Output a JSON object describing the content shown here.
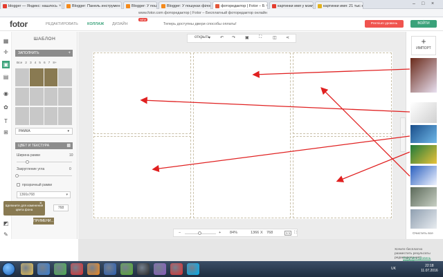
{
  "browser": {
    "tabs": [
      {
        "label": "blogger — Яндекс: нашлось",
        "color": "#e33c2e",
        "active": false
      },
      {
        "label": "Blogger: Панель инструмен",
        "color": "#f48a1c",
        "active": false
      },
      {
        "label": "Blogger: У пошуках філосо",
        "color": "#f48a1c",
        "active": false
      },
      {
        "label": "Blogger: У пошуках філосо",
        "color": "#f48a1c",
        "active": false
      },
      {
        "label": "фоторедактор | Fotor – Б",
        "color": "#e2563a",
        "active": true
      },
      {
        "label": "картинки имя у мэму м",
        "color": "#e33c2e",
        "active": false
      },
      {
        "label": "картинки имя: 21 тыс кар",
        "color": "#e3b21c",
        "active": false
      }
    ],
    "close_glyph": "×",
    "window_controls": [
      "–",
      "□",
      "×"
    ],
    "address": "www.fotor.com  фоторедактор | Fotor – Бесплатный фоторедактор онлайн"
  },
  "app": {
    "logo": "fotor",
    "nav": [
      {
        "label": "РЕДАКТИРОВАТЬ",
        "active": false
      },
      {
        "label": "КОЛЛАЖ",
        "active": true
      },
      {
        "label": "ДИЗАЙН",
        "active": false
      }
    ],
    "new_badge": "NEW",
    "notice": "Теперь доступны двери способы оплаты!",
    "premium_button": "Premium уровень",
    "login_button": "ВОЙТИ"
  },
  "left_panel": {
    "title": "ШАБЛОН",
    "fill_label": "ЗАПОЛНИТЬ",
    "fill_plus": "+",
    "numbers": [
      "Все",
      "2",
      "3",
      "4",
      "5",
      "6",
      "7",
      "8+"
    ],
    "frame_dropdown": "РАМКА",
    "frame_dropdown_arrow": "▾",
    "color_texture_label": "ЦВЕТ И ТЕКСТУРА",
    "border_width_label": "Ширина рамки",
    "border_width_value": "10",
    "corner_radius_label": "Закругление угла",
    "corner_radius_value": "0",
    "transparent_label": "прозрачный рамки",
    "resolution_select": "1366x768",
    "resolution_arrow": "▾",
    "height_value": "768",
    "apply_button": "ПРИМЕНИ...",
    "tip_text": "Щелкните для изменения цвета фона",
    "tip_close": "×"
  },
  "toolbar": {
    "open_label": "открыть",
    "open_arrow": "▾",
    "undo": "↶",
    "redo": "↷",
    "save": "▣",
    "fit": "⛶",
    "compare": "◫",
    "share": "⋖"
  },
  "zoom": {
    "minus": "−",
    "plus": "+",
    "percent": "84%",
    "width": "1366",
    "x": "X",
    "height": "768",
    "fit_icon": "1:1",
    "full_icon": "⛶"
  },
  "right_panel": {
    "import_plus": "+",
    "import_label": "ИМПОРТ",
    "collapse_arrow": "›",
    "clear_all": "Очистить все",
    "thumbs": [
      {
        "c1": "#6a2a1a",
        "c2": "#e8e0f0"
      },
      {
        "c1": "#ffffff",
        "c2": "#d0d0d0"
      },
      {
        "c1": "#1a4d8a",
        "c2": "#6fb8e8"
      },
      {
        "c1": "#1f7a3a",
        "c2": "#e8c23a"
      },
      {
        "c1": "#2a5fbf",
        "c2": "#f0f4ff"
      },
      {
        "c1": "#5c6a5a",
        "c2": "#c8d0c4"
      },
      {
        "c1": "#8f9fb0",
        "c2": "#e8ecf0"
      }
    ]
  },
  "promo": {
    "text": "Хочите бесплатно разместить результаты редактирования?",
    "link": "Получить уровень сейчас!"
  },
  "taskbar": {
    "lang": "UK",
    "time": "22:18",
    "date": "11.07.2016",
    "apps": [
      {
        "name": "explorer",
        "color": "#e8c050"
      },
      {
        "name": "media-player",
        "color": "#3a7fd0"
      },
      {
        "name": "chrome",
        "color": "#4caf50"
      },
      {
        "name": "opera",
        "color": "#e03030"
      },
      {
        "name": "firefox",
        "color": "#f08a20"
      },
      {
        "name": "word",
        "color": "#2b5fb3"
      },
      {
        "name": "utorrent",
        "color": "#58b030"
      },
      {
        "name": "app-8",
        "color": "#2a2a2a"
      },
      {
        "name": "app-9",
        "color": "#8a5cc0"
      },
      {
        "name": "yandex",
        "color": "#e03030"
      },
      {
        "name": "skype",
        "color": "#00aff0"
      }
    ]
  },
  "colors": {
    "accent_green": "#3aa27a",
    "accent_gold": "#897a52",
    "arrow_red": "#e02020"
  }
}
